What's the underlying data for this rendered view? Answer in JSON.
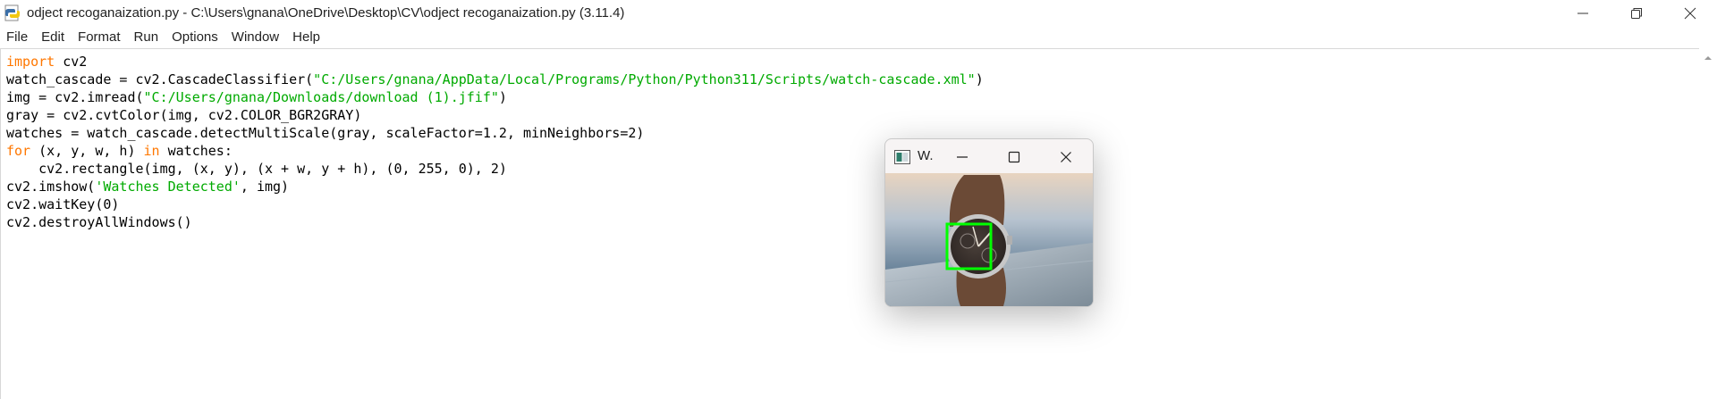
{
  "window": {
    "title": "odject recoganaization.py - C:\\Users\\gnana\\OneDrive\\Desktop\\CV\\odject recoganaization.py (3.11.4)"
  },
  "menu": [
    "File",
    "Edit",
    "Format",
    "Run",
    "Options",
    "Window",
    "Help"
  ],
  "code": {
    "line1": {
      "kw": "import",
      "rest": " cv2"
    },
    "line2": {
      "pre": "watch_cascade = cv2.CascadeClassifier(",
      "str": "\"C:/Users/gnana/AppData/Local/Programs/Python/Python311/Scripts/watch-cascade.xml\"",
      "post": ")"
    },
    "line3": {
      "pre": "img = cv2.imread(",
      "str": "\"C:/Users/gnana/Downloads/download (1).jfif\"",
      "post": ")"
    },
    "line4": "gray = cv2.cvtColor(img, cv2.COLOR_BGR2GRAY)",
    "line5": "watches = watch_cascade.detectMultiScale(gray, scaleFactor=1.2, minNeighbors=2)",
    "line6": {
      "kw1": "for",
      "mid": " (x, y, w, h) ",
      "kw2": "in",
      "post": " watches:"
    },
    "line7": "    cv2.rectangle(img, (x, y), (x + w, y + h), (0, 255, 0), 2)",
    "line8": {
      "pre": "cv2.imshow(",
      "str": "'Watches Detected'",
      "post": ", img)"
    },
    "line9": "cv2.waitKey(0)",
    "line10": "cv2.destroyAllWindows()"
  },
  "popup": {
    "title": "W."
  },
  "colors": {
    "keyword": "#ff7700",
    "string": "#00aa00",
    "detection_box": "#00ff00"
  }
}
